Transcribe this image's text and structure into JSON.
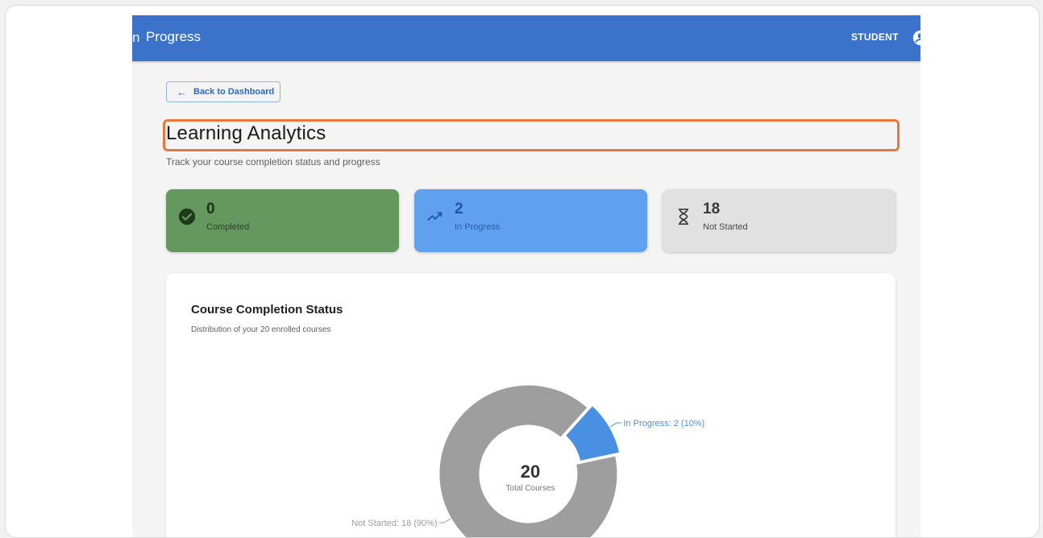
{
  "app_bar": {
    "cut_text": "n",
    "title": "Progress",
    "role": "STUDENT"
  },
  "back_button": {
    "label": "Back to Dashboard",
    "icon": "arrow-left-icon"
  },
  "page": {
    "title": "Learning Analytics",
    "subtitle": "Track your course completion status and progress"
  },
  "stats": [
    {
      "value": "0",
      "label": "Completed",
      "icon": "check-circle-icon",
      "color": "#65985f"
    },
    {
      "value": "2",
      "label": "In Progress",
      "icon": "trending-up-icon",
      "color": "#5fa1ee"
    },
    {
      "value": "18",
      "label": "Not Started",
      "icon": "hourglass-icon",
      "color": "#e1e1e1"
    }
  ],
  "panel": {
    "title": "Course Completion Status",
    "subtitle": "Distribution of your 20 enrolled courses"
  },
  "chart_data": {
    "type": "pie",
    "center_value": "20",
    "center_label": "Total Courses",
    "slices": [
      {
        "name": "In Progress",
        "value": 2,
        "label": "In Progress: 2 (10%)",
        "color": "#4a90e2"
      },
      {
        "name": "Not Started",
        "value": 18,
        "label": "Not Started: 18 (90%)",
        "color": "#9e9e9e"
      }
    ]
  },
  "colors": {
    "app_bar": "#3a73c9",
    "highlight": "#e6773d"
  }
}
